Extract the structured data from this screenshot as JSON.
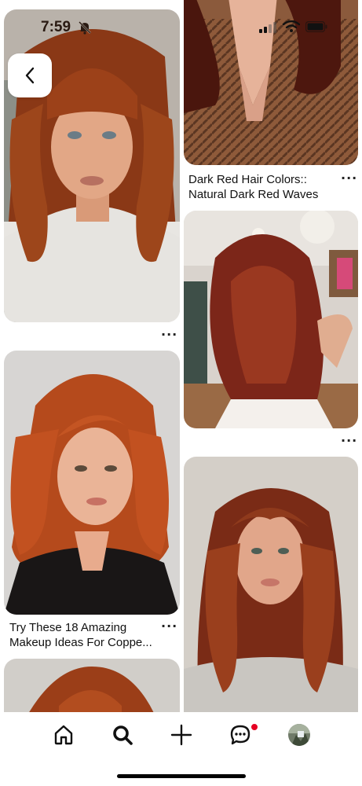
{
  "status_bar": {
    "time": "7:59"
  },
  "pins": {
    "pin1": {
      "more_label": "···"
    },
    "pin2": {
      "title_line1": "Dark Red Hair Colors::",
      "title_line2": "Natural Dark Red Waves",
      "more_label": "···"
    },
    "pin3": {
      "more_label": "···"
    },
    "pin4": {
      "title_line1": "Try These 18 Amazing",
      "title_line2": "Makeup Ideas For Coppe...",
      "more_label": "···"
    }
  },
  "nav": {
    "items": [
      "home",
      "search",
      "create",
      "messages",
      "profile"
    ],
    "messages_badge_color": "#e60023"
  },
  "colors": {
    "accent": "#e60023",
    "background": "#ffffff"
  }
}
